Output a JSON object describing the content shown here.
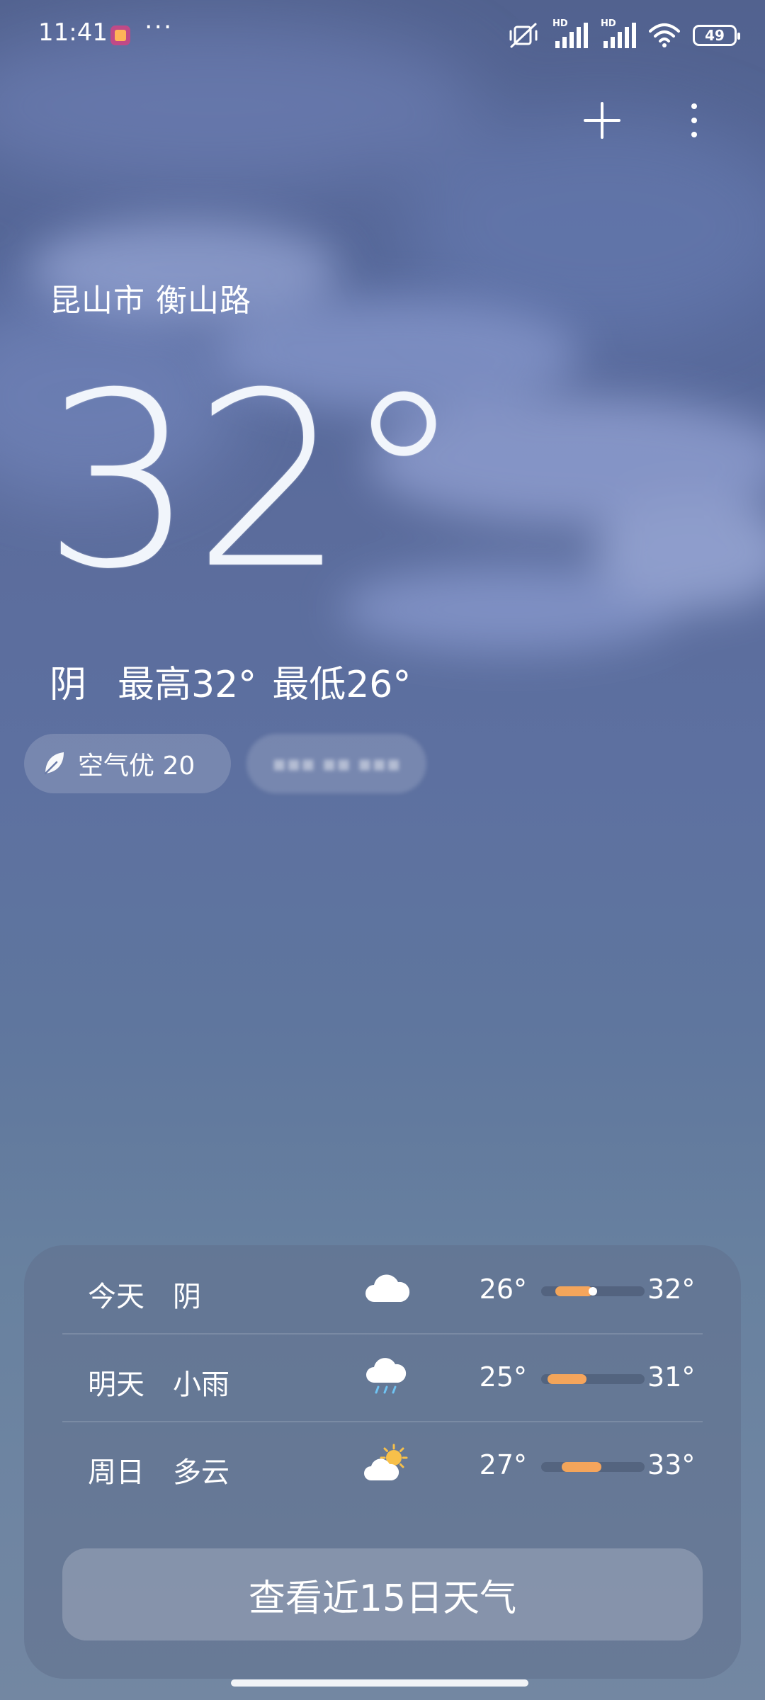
{
  "status_bar": {
    "time": "11:41",
    "more": "···",
    "network_1": "HD",
    "network_2": "HD",
    "battery": "49"
  },
  "location": "昆山市 衡山路",
  "current": {
    "temperature": "32°",
    "condition": "阴",
    "high": "最高32°",
    "low": "最低26°"
  },
  "air_quality": {
    "label": "空气优 20"
  },
  "forecast": [
    {
      "day": "今天",
      "condition": "阴",
      "icon": "cloud-icon",
      "low": "26°",
      "high": "32°",
      "range_start": 0.14,
      "range_end": 0.5,
      "current_marker": 0.5
    },
    {
      "day": "明天",
      "condition": "小雨",
      "icon": "rain-cloud-icon",
      "low": "25°",
      "high": "31°",
      "range_start": 0.06,
      "range_end": 0.44
    },
    {
      "day": "周日",
      "condition": "多云",
      "icon": "partly-cloudy-icon",
      "low": "27°",
      "high": "33°",
      "range_start": 0.2,
      "range_end": 0.58
    }
  ],
  "forecast_button": "查看近15日天气",
  "colors": {
    "accent_bar": "#f2a55a",
    "sky_top": "#52628f",
    "sky_bottom": "#7387a2"
  }
}
